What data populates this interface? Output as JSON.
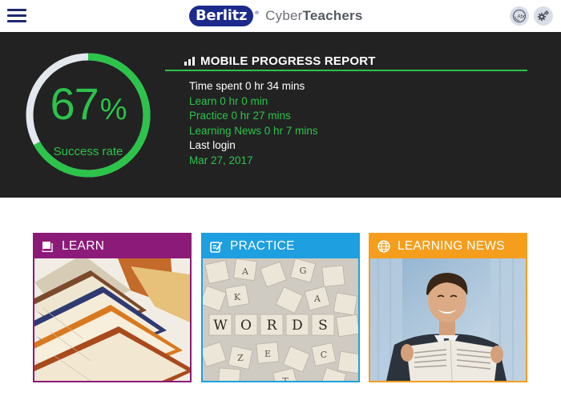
{
  "header": {
    "brand_logo_text": "Berlitz",
    "brand_reg": "®",
    "app_name_light": "Cyber",
    "app_name_bold": "Teachers",
    "icons": [
      "menu-icon",
      "abc-language-icon",
      "settings-gear-icon"
    ]
  },
  "progress": {
    "percent": 67,
    "percent_value": "67",
    "percent_symbol": "%",
    "success_label": "Success rate",
    "report_title": "MOBILE PROGRESS REPORT",
    "time_spent": "Time spent 0 hr 34 mins",
    "learn": "Learn 0 hr 0 min",
    "practice": "Practice 0 hr 27 mins",
    "learning_news": "Learning News 0 hr 7 mins",
    "last_login_label": "Last login",
    "last_login_date": "Mar 27, 2017"
  },
  "cards": [
    {
      "label": "LEARN",
      "icon": "book-icon",
      "image": "stacked-books-photo"
    },
    {
      "label": "PRACTICE",
      "icon": "edit-note-icon",
      "image": "word-tiles-photo"
    },
    {
      "label": "LEARNING NEWS",
      "icon": "globe-icon",
      "image": "man-reading-newspaper-photo"
    }
  ],
  "colors": {
    "brand_navy": "#1c2a8c",
    "panel_bg": "#222222",
    "success_green": "#2cc34b",
    "ring_track": "#e3e7ee",
    "learn": "#8c1a78",
    "practice": "#1e9fe0",
    "news": "#f59e1d"
  }
}
